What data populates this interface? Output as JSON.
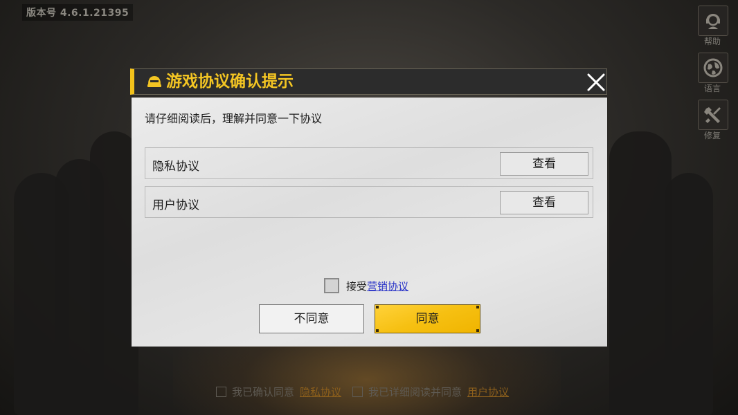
{
  "version_label": "版本号 4.6.1.21395",
  "side_menu": [
    {
      "label": "帮助",
      "icon": "support-agent-icon"
    },
    {
      "label": "语言",
      "icon": "globe-icon"
    },
    {
      "label": "修复",
      "icon": "repair-tools-icon"
    }
  ],
  "dialog": {
    "title": "游戏协议确认提示",
    "intro": "请仔细阅读后，理解并同意一下协议",
    "agreements": [
      {
        "label": "隐私协议",
        "button": "查看"
      },
      {
        "label": "用户协议",
        "button": "查看"
      }
    ],
    "marketing": {
      "prefix": "接受",
      "link": "营销协议",
      "checked": false
    },
    "disagree_label": "不同意",
    "agree_label": "同意"
  },
  "bottom_consent": {
    "item1_text": "我已确认同意",
    "item1_link": "隐私协议",
    "item2_text": "我已详细阅读并同意",
    "item2_link": "用户协议"
  },
  "colors": {
    "accent": "#f2c21b",
    "title_text": "#f3c523",
    "link": "#2a34c8"
  }
}
